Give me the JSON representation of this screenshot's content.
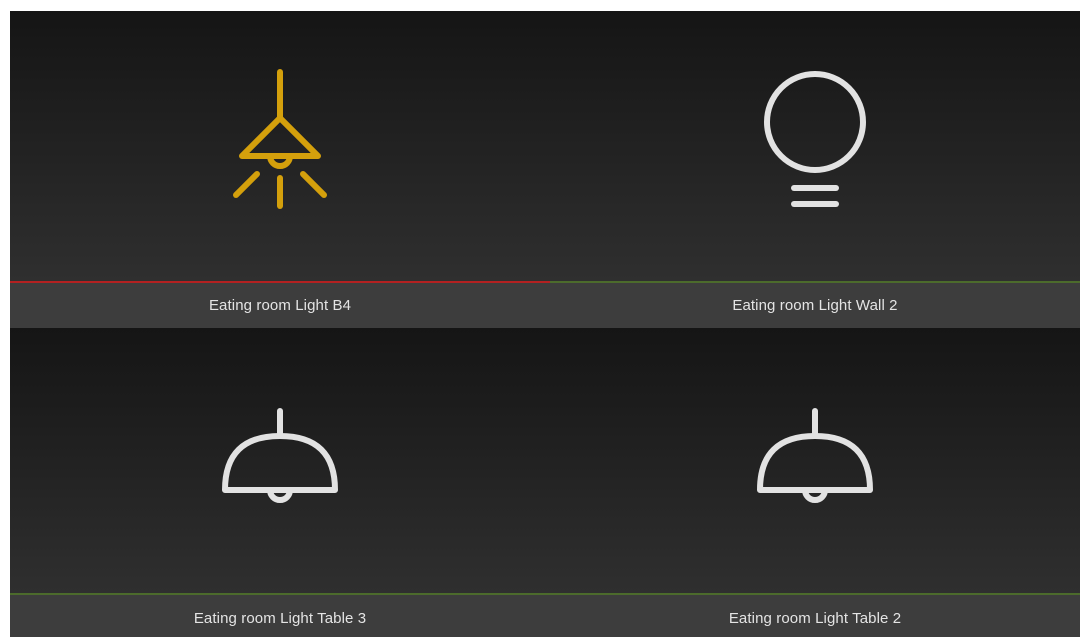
{
  "tiles": [
    {
      "label": "Eating room Light B4",
      "icon": "ceiling-lamp-on-icon",
      "state": "on",
      "status_color": "#b32121",
      "icon_color": "#d4a00c"
    },
    {
      "label": "Eating room Light Wall 2",
      "icon": "light-bulb-off-icon",
      "state": "off",
      "status_color": "#4c6b2c",
      "icon_color": "#e2e2e2"
    },
    {
      "label": "Eating room Light Table 3",
      "icon": "pendant-lamp-off-icon",
      "state": "off",
      "status_color": "#4c6b2c",
      "icon_color": "#e2e2e2"
    },
    {
      "label": "Eating room Light Table 2",
      "icon": "pendant-lamp-off-icon",
      "state": "off",
      "status_color": "#4c6b2c",
      "icon_color": "#e2e2e2"
    }
  ]
}
